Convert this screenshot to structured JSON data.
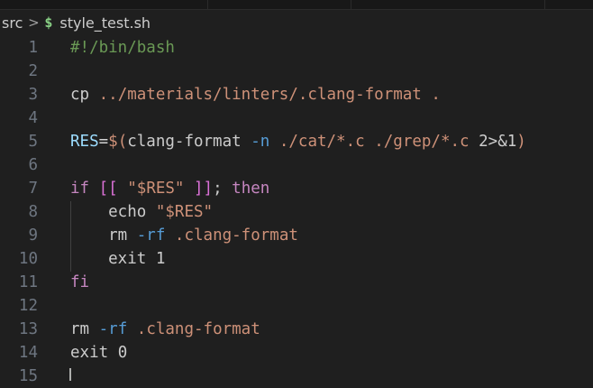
{
  "breadcrumb": {
    "folder": "src",
    "separator": ">",
    "file_icon": "$",
    "file_icon_name": "shell-script-icon",
    "file": "style_test.sh"
  },
  "colors": {
    "background": "#1f1f1f",
    "comment": "#6a9955",
    "string": "#ce9178",
    "variable": "#9cdcfe",
    "keyword": "#c586c0",
    "flag": "#569cd6",
    "line_number": "#6e7681",
    "shell_icon": "#89d185"
  },
  "editor": {
    "lines": [
      {
        "num": "1",
        "tokens": [
          {
            "t": "#!/bin/bash",
            "c": "comment"
          }
        ]
      },
      {
        "num": "2",
        "tokens": []
      },
      {
        "num": "3",
        "tokens": [
          {
            "t": "cp",
            "c": "plain"
          },
          {
            "t": " ",
            "c": "plain"
          },
          {
            "t": "../materials/linters/.clang-format",
            "c": "str"
          },
          {
            "t": " ",
            "c": "plain"
          },
          {
            "t": ".",
            "c": "str"
          }
        ]
      },
      {
        "num": "4",
        "tokens": []
      },
      {
        "num": "5",
        "tokens": [
          {
            "t": "RES",
            "c": "var"
          },
          {
            "t": "=",
            "c": "op"
          },
          {
            "t": "$(",
            "c": "str"
          },
          {
            "t": "clang-format",
            "c": "plain"
          },
          {
            "t": " ",
            "c": "plain"
          },
          {
            "t": "-n",
            "c": "flag"
          },
          {
            "t": " ",
            "c": "plain"
          },
          {
            "t": "./cat/*.c",
            "c": "str"
          },
          {
            "t": " ",
            "c": "plain"
          },
          {
            "t": "./grep/*.c",
            "c": "str"
          },
          {
            "t": " ",
            "c": "plain"
          },
          {
            "t": "2>&1",
            "c": "plain"
          },
          {
            "t": ")",
            "c": "str"
          }
        ]
      },
      {
        "num": "6",
        "tokens": []
      },
      {
        "num": "7",
        "tokens": [
          {
            "t": "if",
            "c": "kw"
          },
          {
            "t": " ",
            "c": "plain"
          },
          {
            "t": "[[",
            "c": "br2"
          },
          {
            "t": " ",
            "c": "plain"
          },
          {
            "t": "\"$RES\"",
            "c": "str"
          },
          {
            "t": " ",
            "c": "plain"
          },
          {
            "t": "]]",
            "c": "br2"
          },
          {
            "t": "; ",
            "c": "plain"
          },
          {
            "t": "then",
            "c": "kw"
          }
        ]
      },
      {
        "num": "8",
        "tokens": [
          {
            "t": "    echo",
            "c": "plain"
          },
          {
            "t": " ",
            "c": "plain"
          },
          {
            "t": "\"$RES\"",
            "c": "str"
          }
        ]
      },
      {
        "num": "9",
        "tokens": [
          {
            "t": "    rm",
            "c": "plain"
          },
          {
            "t": " ",
            "c": "plain"
          },
          {
            "t": "-rf",
            "c": "flag"
          },
          {
            "t": " ",
            "c": "plain"
          },
          {
            "t": ".clang-format",
            "c": "str"
          }
        ]
      },
      {
        "num": "10",
        "tokens": [
          {
            "t": "    exit",
            "c": "plain"
          },
          {
            "t": " ",
            "c": "plain"
          },
          {
            "t": "1",
            "c": "plain"
          }
        ]
      },
      {
        "num": "11",
        "tokens": [
          {
            "t": "fi",
            "c": "kw"
          }
        ]
      },
      {
        "num": "12",
        "tokens": []
      },
      {
        "num": "13",
        "tokens": [
          {
            "t": "rm",
            "c": "plain"
          },
          {
            "t": " ",
            "c": "plain"
          },
          {
            "t": "-rf",
            "c": "flag"
          },
          {
            "t": " ",
            "c": "plain"
          },
          {
            "t": ".clang-format",
            "c": "str"
          }
        ]
      },
      {
        "num": "14",
        "tokens": [
          {
            "t": "exit",
            "c": "plain"
          },
          {
            "t": " ",
            "c": "plain"
          },
          {
            "t": "0",
            "c": "plain"
          }
        ]
      },
      {
        "num": "15",
        "tokens": []
      }
    ]
  }
}
